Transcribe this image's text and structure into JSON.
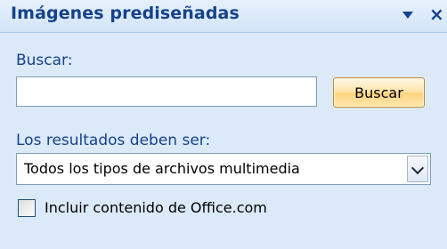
{
  "pane": {
    "title": "Imágenes prediseñadas",
    "menu_icon": "dropdown-triangle",
    "close_symbol": "×"
  },
  "search": {
    "label": "Buscar:",
    "value": "",
    "placeholder": "",
    "button_label": "Buscar"
  },
  "results": {
    "label": "Los resultados deben ser:",
    "selected_option": "Todos los tipos de archivos multimedia"
  },
  "office_content": {
    "label": "Incluir contenido de Office.com",
    "checked": false
  },
  "colors": {
    "pane_background": "#dbe9f9",
    "title_text": "#15428b",
    "button_border": "#c28a30"
  }
}
